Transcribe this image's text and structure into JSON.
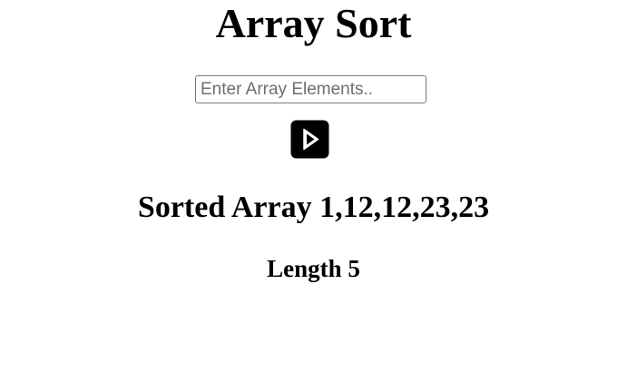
{
  "page": {
    "title": "Array Sort",
    "input": {
      "placeholder": "Enter Array Elements..",
      "value": ""
    },
    "play_button": {
      "icon": "play-icon",
      "color": "#000000"
    },
    "result": {
      "sorted_label": "Sorted Array",
      "sorted_values": "1,12,12,23,23",
      "length_label": "Length",
      "length_value": "5"
    }
  }
}
